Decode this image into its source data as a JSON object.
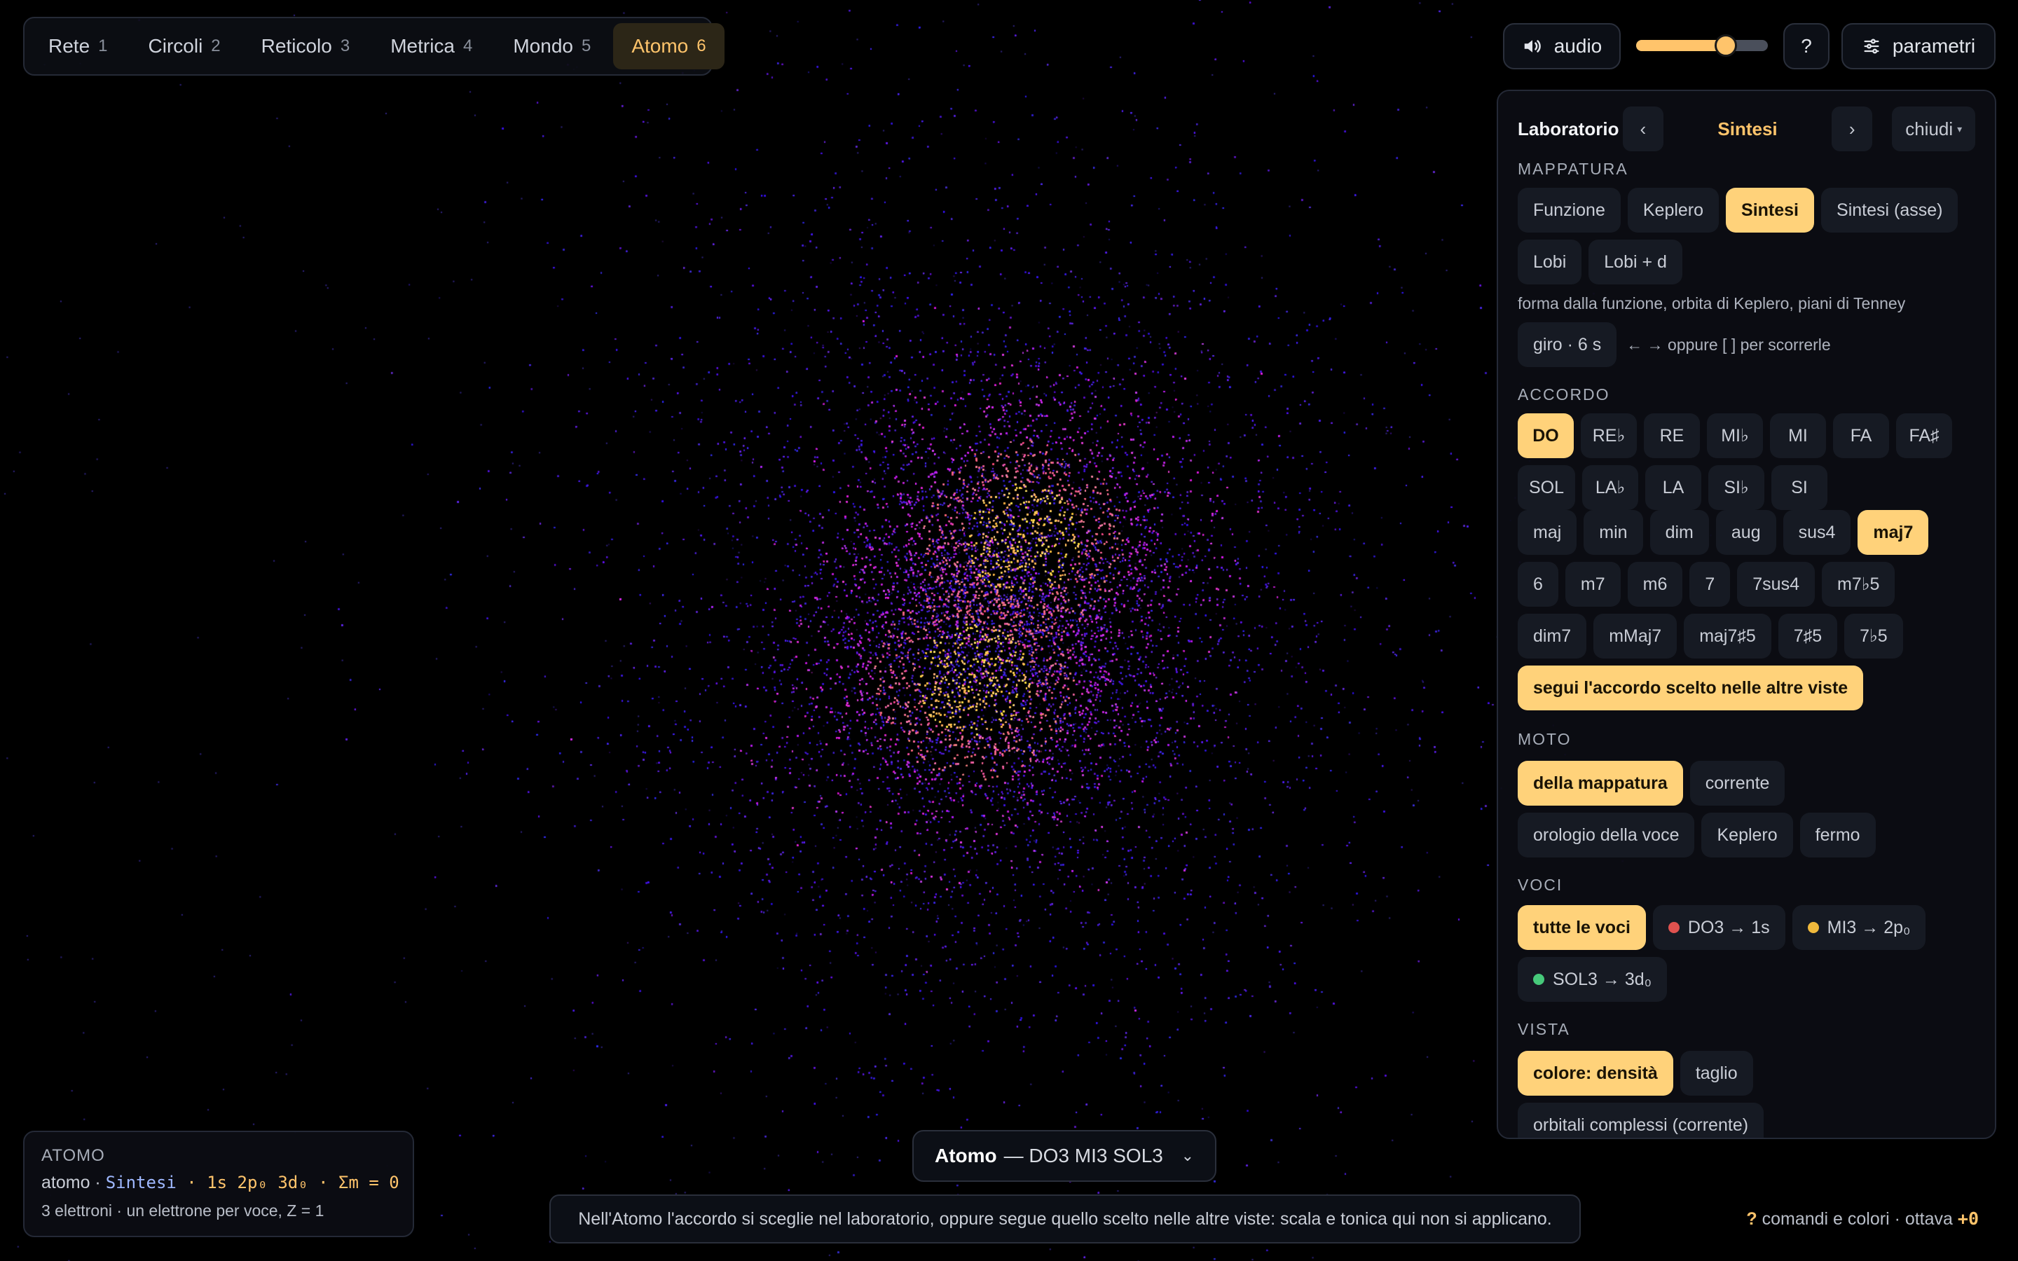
{
  "tabs": [
    {
      "label": "Rete",
      "num": "1"
    },
    {
      "label": "Circoli",
      "num": "2"
    },
    {
      "label": "Reticolo",
      "num": "3"
    },
    {
      "label": "Metrica",
      "num": "4"
    },
    {
      "label": "Mondo",
      "num": "5"
    },
    {
      "label": "Atomo",
      "num": "6"
    }
  ],
  "active_tab": "Atomo",
  "controls": {
    "audio_label": "audio",
    "volume": 0.68,
    "help_label": "?",
    "params_label": "parametri"
  },
  "panel": {
    "title": "Laboratorio",
    "prev": "‹",
    "current": "Sintesi",
    "next": "›",
    "close": "chiudi",
    "close_caret": "▾",
    "mappatura": {
      "label": "MAPPATURA",
      "options": [
        "Funzione",
        "Keplero",
        "Sintesi",
        "Sintesi (asse)",
        "Lobi",
        "Lobi + d"
      ],
      "desc": "forma dalla funzione, orbita di Keplero, piani di Tenney",
      "giro": "giro · 6 s",
      "hint": "← → oppure [ ] per scorrerle"
    },
    "accordo": {
      "label": "ACCORDO",
      "roots": [
        "DO",
        "RE♭",
        "RE",
        "MI♭",
        "MI",
        "FA",
        "FA♯",
        "SOL",
        "LA♭",
        "LA",
        "SI♭",
        "SI"
      ],
      "qualities": [
        "maj",
        "min",
        "dim",
        "aug",
        "sus4",
        "maj7",
        "6",
        "m7",
        "m6",
        "7",
        "7sus4",
        "m7♭5",
        "dim7",
        "mMaj7",
        "maj7♯5",
        "7♯5",
        "7♭5"
      ],
      "follow": "segui l'accordo scelto nelle altre viste"
    },
    "moto": {
      "label": "MOTO",
      "options": [
        "della mappatura",
        "corrente",
        "orologio della voce",
        "Keplero",
        "fermo"
      ]
    },
    "voci": {
      "label": "VOCI",
      "all": "tutte le voci",
      "voices": [
        {
          "label": "DO3 → 1s",
          "color": "#e0524f"
        },
        {
          "label": "MI3 → 2p₀",
          "color": "#f0b93c"
        },
        {
          "label": "SOL3 → 3d₀",
          "color": "#46c97a"
        }
      ]
    },
    "vista": {
      "label": "VISTA",
      "options": [
        "colore: densità",
        "taglio",
        "orbitali complessi (corrente)"
      ]
    }
  },
  "info": {
    "title": "ATOMO",
    "prefix": "atomo · ",
    "mode": "Sintesi",
    "formula": " · 1s 2p₀ 3d₀ · Σm = 0",
    "sub": "3 elettroni · un elettrone per voce, Z = 1"
  },
  "chord_box": {
    "name": "Atomo",
    "notes": "— DO3 MI3 SOL3",
    "chevron": "⌄"
  },
  "notice": "Nell'Atomo l'accordo si sceglie nel laboratorio, oppure segue quello scelto nelle altre viste: scala e tonica qui non si applicano.",
  "footer": {
    "q": "?",
    "text": " comandi e colori · ottava ",
    "octave": "+0"
  },
  "colors": {
    "accent": "#ffc46b",
    "chip_selected": "#ffd27a",
    "density_low": "#3a1cff",
    "density_mid": "#d62cc8",
    "density_high": "#ffb347"
  }
}
